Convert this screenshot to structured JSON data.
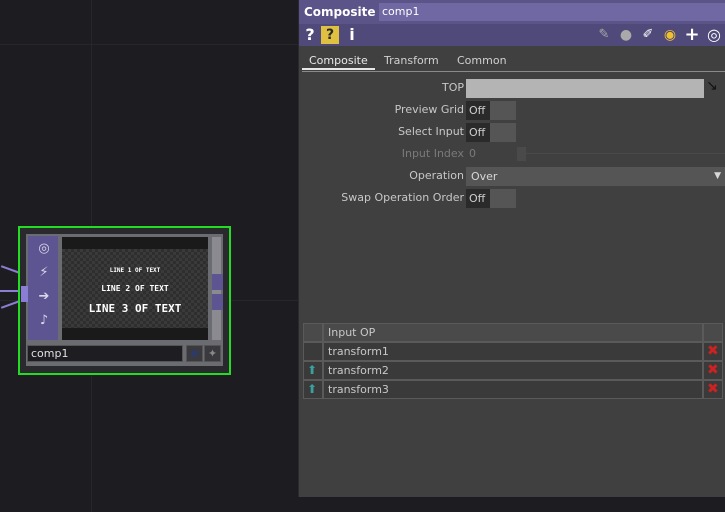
{
  "node": {
    "name": "comp1",
    "preview_lines": [
      "LINE 1 OF TEXT",
      "LINE 2 OF TEXT",
      "LINE 3 OF TEXT"
    ]
  },
  "panel": {
    "op_type": "Composite",
    "op_name": "comp1",
    "toolbar": {
      "help": "?",
      "python_help": "?",
      "info": "i"
    },
    "tabs": [
      {
        "label": "Composite",
        "active": true
      },
      {
        "label": "Transform",
        "active": false
      },
      {
        "label": "Common",
        "active": false
      }
    ],
    "params": {
      "top_label": "TOP",
      "top_value": "",
      "preview_grid_label": "Preview Grid",
      "preview_grid_value": "Off",
      "select_input_label": "Select Input",
      "select_input_value": "Off",
      "input_index_label": "Input Index",
      "input_index_value": "0",
      "operation_label": "Operation",
      "operation_value": "Over",
      "swap_label": "Swap Operation Order",
      "swap_value": "Off"
    },
    "table": {
      "header": "Input OP",
      "rows": [
        "transform1",
        "transform2",
        "transform3"
      ]
    }
  },
  "colors": {
    "node_border": "#22dd22",
    "header": "#5b5489",
    "delete": "#cc2222",
    "move_up": "#3aa0a0"
  }
}
